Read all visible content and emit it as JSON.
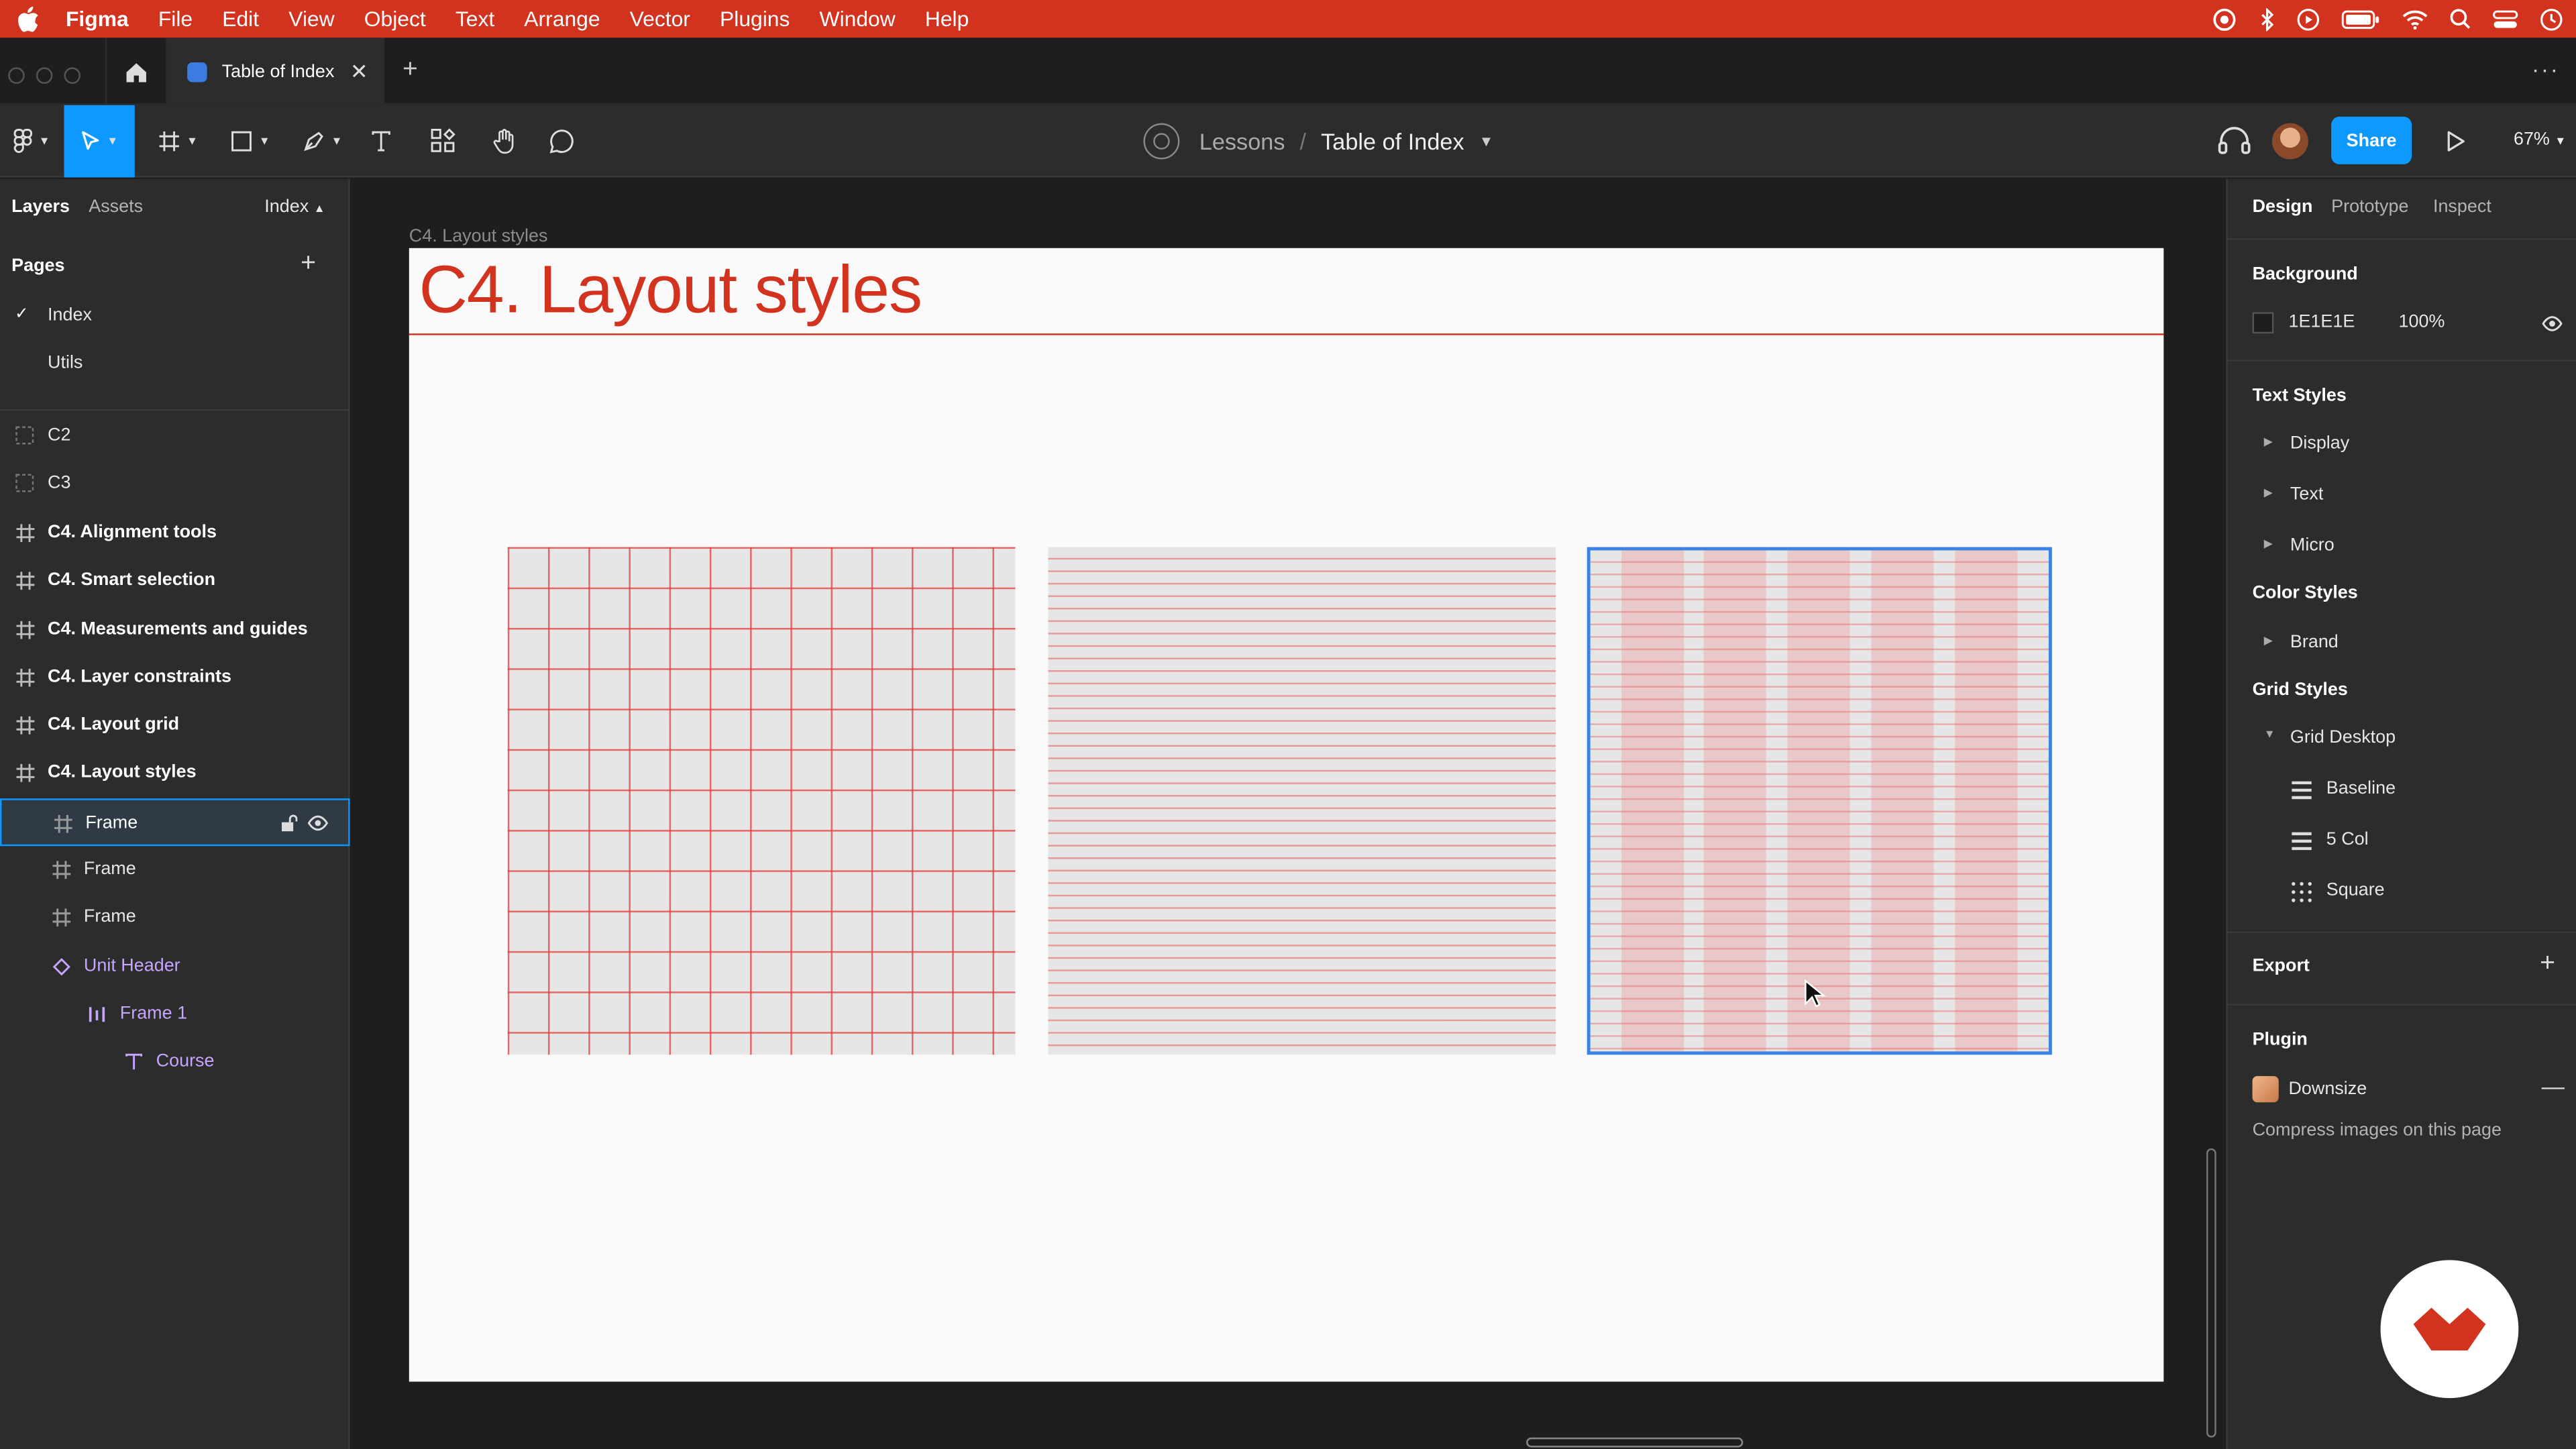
{
  "menubar": {
    "app": "Figma",
    "items": [
      "File",
      "Edit",
      "View",
      "Object",
      "Text",
      "Arrange",
      "Vector",
      "Plugins",
      "Window",
      "Help"
    ]
  },
  "tabbar": {
    "tab_title": "Table of Index",
    "new_tab": "+",
    "close": "✕",
    "more": "···"
  },
  "toolbar": {
    "breadcrumb_project": "Lessons",
    "breadcrumb_sep": "/",
    "breadcrumb_file": "Table of Index",
    "share_label": "Share",
    "zoom": "67%"
  },
  "left_panel": {
    "tabs": [
      "Layers",
      "Assets"
    ],
    "page_selector": "Index",
    "pages_title": "Pages",
    "pages": [
      {
        "label": "Index",
        "current": true
      },
      {
        "label": "Utils",
        "current": false
      }
    ],
    "layers": [
      {
        "label": "C2",
        "icon": "section-icon"
      },
      {
        "label": "C3",
        "icon": "section-icon"
      },
      {
        "label": "C4. Alignment tools",
        "icon": "frame-icon"
      },
      {
        "label": "C4. Smart selection",
        "icon": "frame-icon"
      },
      {
        "label": "C4. Measurements and guides",
        "icon": "frame-icon"
      },
      {
        "label": "C4. Layer constraints",
        "icon": "frame-icon"
      },
      {
        "label": "C4. Layout grid",
        "icon": "frame-icon"
      },
      {
        "label": "C4. Layout styles",
        "icon": "frame-icon"
      },
      {
        "label": "Frame",
        "icon": "frame-icon"
      },
      {
        "label": "Frame",
        "icon": "frame-icon"
      },
      {
        "label": "Frame",
        "icon": "frame-icon"
      },
      {
        "label": "Unit Header",
        "icon": "component-icon"
      },
      {
        "label": "Frame 1",
        "icon": "autolayout-icon"
      },
      {
        "label": "Course",
        "icon": "text-icon"
      }
    ]
  },
  "canvas": {
    "frame_label": "C4. Layout styles",
    "board_title": "C4.  Layout styles"
  },
  "right_panel": {
    "tabs": [
      "Design",
      "Prototype",
      "Inspect"
    ],
    "background_title": "Background",
    "background_hex": "1E1E1E",
    "background_opacity": "100%",
    "text_styles_title": "Text Styles",
    "text_styles": [
      "Display",
      "Text",
      "Micro"
    ],
    "color_styles_title": "Color Styles",
    "color_styles": [
      "Brand"
    ],
    "grid_styles_title": "Grid Styles",
    "grid_group": "Grid Desktop",
    "grid_styles": [
      "Baseline",
      "5 Col",
      "Square"
    ],
    "export_title": "Export",
    "plugin_title": "Plugin",
    "plugin_name": "Downsize",
    "plugin_desc": "Compress images on this page"
  },
  "colors": {
    "menubar": "#d2331f",
    "accent": "#0d99ff",
    "brand_red": "#d2331f",
    "canvas_bg": "#1e1e1e"
  }
}
